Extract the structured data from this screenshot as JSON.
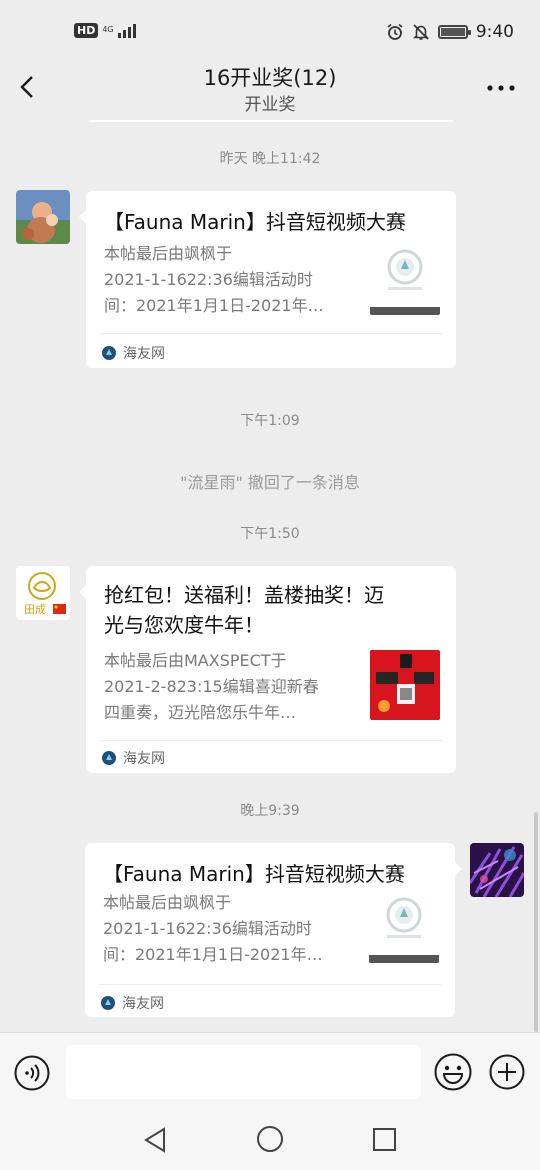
{
  "status_bar": {
    "network_badge": "HD",
    "network_type": "4G",
    "time": "9:40"
  },
  "header": {
    "title": "16开业奖(12)",
    "subtitle": "开业奖"
  },
  "messages": [
    {
      "time": "昨天 晚上11:42",
      "card": {
        "title": "【Fauna Marin】抖音短视频大赛",
        "desc_lines": [
          "本帖最后由飒枫于",
          "2021-1-1622:36编辑活动时",
          "间：2021年1月1日-2021年…"
        ],
        "source": "海友网"
      }
    },
    {
      "time": "下午1:09",
      "notice": "\"流星雨\" 撤回了一条消息"
    },
    {
      "time": "下午1:50",
      "card": {
        "title_lines": [
          "抢红包！送福利！盖楼抽奖！迈",
          "光与您欢度牛年！"
        ],
        "desc_lines": [
          "本帖最后由MAXSPECT于",
          "2021-2-823:15编辑喜迎新春",
          "四重奏，迈光陪您乐牛年…"
        ],
        "source": "海友网"
      }
    },
    {
      "time": "晚上9:39",
      "card": {
        "title": "【Fauna Marin】抖音短视频大赛",
        "desc_lines": [
          "本帖最后由飒枫于",
          "2021-1-1622:36编辑活动时",
          "间：2021年1月1日-2021年…"
        ],
        "source": "海友网"
      }
    }
  ],
  "input": {
    "placeholder": ""
  },
  "colors": {
    "background": "#ededed",
    "bubble": "#ffffff",
    "time_text": "#8a8a8a",
    "desc_text": "#7a7a7a"
  },
  "icons": {
    "back": "chevron-left-icon",
    "more": "more-dots-icon",
    "voice": "voice-icon",
    "emoji": "emoji-icon",
    "plus": "plus-icon"
  }
}
